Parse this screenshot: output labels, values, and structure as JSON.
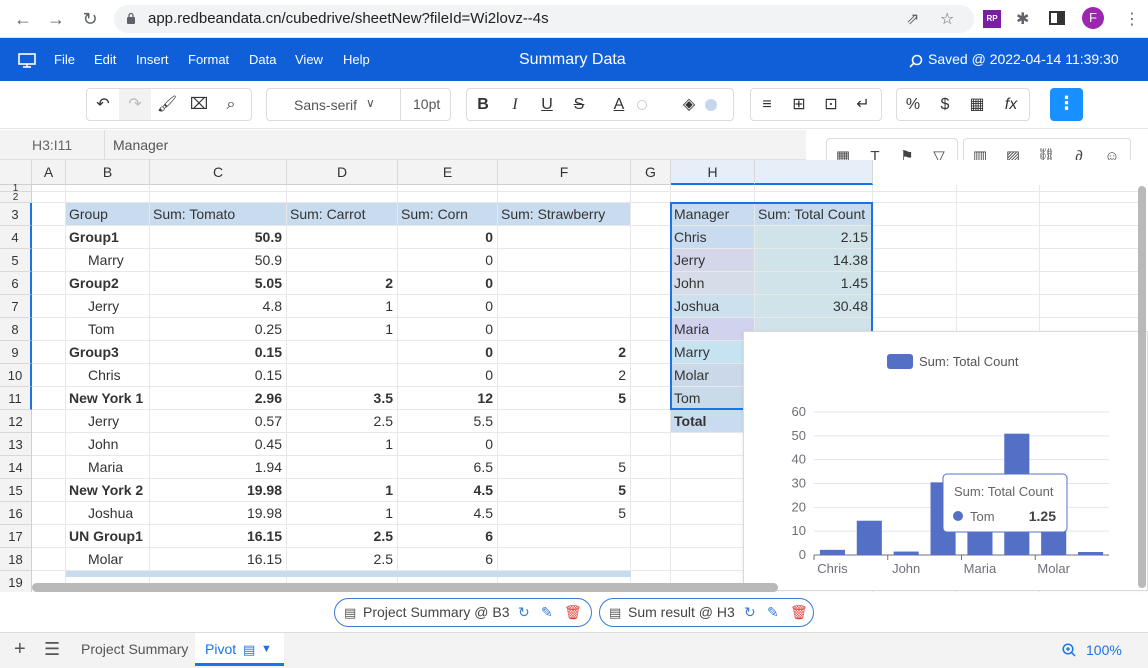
{
  "browser": {
    "url": "app.redbeandata.cn/cubedrive/sheetNew?fileId=Wi2lovz--4s",
    "profile_initial": "F",
    "colors": {
      "profile": "#9c27b0",
      "ext": "#7b1fa2"
    }
  },
  "app": {
    "menu": [
      "File",
      "Edit",
      "Insert",
      "Format",
      "Data",
      "View",
      "Help"
    ],
    "title": "Summary Data",
    "saved": "Saved @ 2022-04-14 11:39:30",
    "accent": "#0e5fd8"
  },
  "toolbar": {
    "font_family": "Sans-serif",
    "font_size": "10pt",
    "more": "⋮"
  },
  "formula_bar": {
    "cell_ref": "H3:I11",
    "value": "Manager"
  },
  "columns": [
    "A",
    "B",
    "C",
    "D",
    "E",
    "F",
    "G",
    "H"
  ],
  "rows": [
    "1",
    "2",
    "3",
    "4",
    "5",
    "6",
    "7",
    "8",
    "9",
    "10",
    "11",
    "12",
    "13",
    "14",
    "15",
    "16",
    "17",
    "18",
    "19"
  ],
  "pivot1": {
    "headers": [
      "Group",
      "Sum: Tomato",
      "Sum: Carrot",
      "Sum: Corn",
      "Sum: Strawberry"
    ],
    "rows": [
      {
        "b": "Group1",
        "c": "50.9",
        "d": "",
        "e": "0",
        "f": "",
        "bold": true
      },
      {
        "b": "Marry",
        "c": "50.9",
        "d": "",
        "e": "0",
        "f": "",
        "bold": false
      },
      {
        "b": "Group2",
        "c": "5.05",
        "d": "2",
        "e": "0",
        "f": "",
        "bold": true
      },
      {
        "b": "Jerry",
        "c": "4.8",
        "d": "1",
        "e": "0",
        "f": "",
        "bold": false
      },
      {
        "b": "Tom",
        "c": "0.25",
        "d": "1",
        "e": "0",
        "f": "",
        "bold": false
      },
      {
        "b": "Group3",
        "c": "0.15",
        "d": "",
        "e": "0",
        "f": "2",
        "bold": true
      },
      {
        "b": "Chris",
        "c": "0.15",
        "d": "",
        "e": "0",
        "f": "2",
        "bold": false
      },
      {
        "b": "New York 1",
        "c": "2.96",
        "d": "3.5",
        "e": "12",
        "f": "5",
        "bold": true
      },
      {
        "b": "Jerry",
        "c": "0.57",
        "d": "2.5",
        "e": "5.5",
        "f": "",
        "bold": false
      },
      {
        "b": "John",
        "c": "0.45",
        "d": "1",
        "e": "0",
        "f": "",
        "bold": false
      },
      {
        "b": "Maria",
        "c": "1.94",
        "d": "",
        "e": "6.5",
        "f": "5",
        "bold": false
      },
      {
        "b": "New York 2",
        "c": "19.98",
        "d": "1",
        "e": "4.5",
        "f": "5",
        "bold": true
      },
      {
        "b": "Joshua",
        "c": "19.98",
        "d": "1",
        "e": "4.5",
        "f": "5",
        "bold": false
      },
      {
        "b": "UN Group1",
        "c": "16.15",
        "d": "2.5",
        "e": "6",
        "f": "",
        "bold": true
      },
      {
        "b": "Molar",
        "c": "16.15",
        "d": "2.5",
        "e": "6",
        "f": "",
        "bold": false
      }
    ]
  },
  "pivot2": {
    "headers": [
      "Manager",
      "Sum: Total Count"
    ],
    "rows": [
      {
        "h": "Chris",
        "i": "2.15"
      },
      {
        "h": "Jerry",
        "i": "14.38"
      },
      {
        "h": "John",
        "i": "1.45"
      },
      {
        "h": "Joshua",
        "i": "30.48"
      },
      {
        "h": "Maria",
        "i": ""
      },
      {
        "h": "Marry",
        "i": ""
      },
      {
        "h": "Molar",
        "i": ""
      },
      {
        "h": "Tom",
        "i": ""
      }
    ],
    "total_label": "Total"
  },
  "chart_data": {
    "type": "bar",
    "legend": "Sum: Total Count",
    "categories": [
      "Chris",
      "Jerry",
      "John",
      "Joshua",
      "Maria",
      "Marry",
      "Molar",
      "Tom"
    ],
    "x_tick_labels": [
      "Chris",
      "John",
      "Maria",
      "Molar"
    ],
    "values": [
      2.15,
      14.38,
      1.45,
      30.48,
      24.0,
      50.9,
      16.15,
      1.25
    ],
    "ylim": [
      0,
      60
    ],
    "yticks": [
      0,
      10,
      20,
      30,
      40,
      50,
      60
    ],
    "bar_color": "#5470c6",
    "tooltip": {
      "title": "Sum: Total Count",
      "name": "Tom",
      "value": "1.25"
    }
  },
  "pivot_tags": [
    {
      "label": "Project Summary @ B3"
    },
    {
      "label": "Sum result @ H3"
    }
  ],
  "bottom": {
    "sheets": [
      "Project Summary",
      "Pivot"
    ],
    "zoom": "100%"
  }
}
